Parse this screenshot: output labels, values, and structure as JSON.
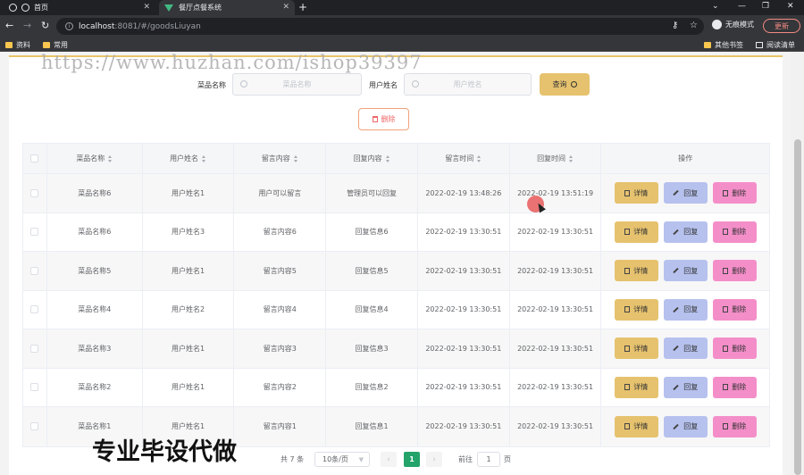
{
  "browser": {
    "tabs": [
      {
        "label": "首页",
        "active": false
      },
      {
        "label": "餐厅点餐系统",
        "active": true
      }
    ],
    "url_host": "localhost",
    "url_path": ":8081/#/goodsLiuyan",
    "incognito_label": "无痕模式",
    "update_label": "更新",
    "bookmarks": [
      "资料",
      "常用"
    ],
    "bookmarks_right": [
      "其他书签",
      "阅读清单"
    ]
  },
  "watermark": "https://www.huzhan.com/ishop39397",
  "overlay_text": "专业毕设代做",
  "search": {
    "dish_label": "菜品名称",
    "dish_placeholder": "菜品名称",
    "user_label": "用户姓名",
    "user_placeholder": "用户姓名",
    "query_label": "查询"
  },
  "delete_label": "删除",
  "table": {
    "headers": [
      "菜品名称",
      "用户姓名",
      "留言内容",
      "回复内容",
      "留言时间",
      "回复时间",
      "操作"
    ],
    "rows": [
      {
        "dish": "菜品名称6",
        "user": "用户姓名1",
        "message": "用户可以留言",
        "reply": "管理员可以回复",
        "msg_time": "2022-02-19 13:48:26",
        "reply_time": "2022-02-19 13:51:19"
      },
      {
        "dish": "菜品名称6",
        "user": "用户姓名3",
        "message": "留言内容6",
        "reply": "回复信息6",
        "msg_time": "2022-02-19 13:30:51",
        "reply_time": "2022-02-19 13:30:51"
      },
      {
        "dish": "菜品名称5",
        "user": "用户姓名1",
        "message": "留言内容5",
        "reply": "回复信息5",
        "msg_time": "2022-02-19 13:30:51",
        "reply_time": "2022-02-19 13:30:51"
      },
      {
        "dish": "菜品名称4",
        "user": "用户姓名2",
        "message": "留言内容4",
        "reply": "回复信息4",
        "msg_time": "2022-02-19 13:30:51",
        "reply_time": "2022-02-19 13:30:51"
      },
      {
        "dish": "菜品名称3",
        "user": "用户姓名1",
        "message": "留言内容3",
        "reply": "回复信息3",
        "msg_time": "2022-02-19 13:30:51",
        "reply_time": "2022-02-19 13:30:51"
      },
      {
        "dish": "菜品名称2",
        "user": "用户姓名1",
        "message": "留言内容2",
        "reply": "回复信息2",
        "msg_time": "2022-02-19 13:30:51",
        "reply_time": "2022-02-19 13:30:51"
      },
      {
        "dish": "菜品名称1",
        "user": "用户姓名1",
        "message": "留言内容1",
        "reply": "回复信息1",
        "msg_time": "2022-02-19 13:30:51",
        "reply_time": "2022-02-19 13:30:51"
      }
    ],
    "actions": {
      "detail": "详情",
      "reply": "回复",
      "delete": "删除"
    }
  },
  "pagination": {
    "total_label": "共 7 条",
    "page_size": "10条/页",
    "current_page": "1",
    "goto_prefix": "前往",
    "goto_value": "1",
    "goto_suffix": "页"
  },
  "colors": {
    "accent": "#e6c26e",
    "reply": "#b6c1ee",
    "danger": "#f48ec9",
    "page_active": "#24a36b"
  }
}
